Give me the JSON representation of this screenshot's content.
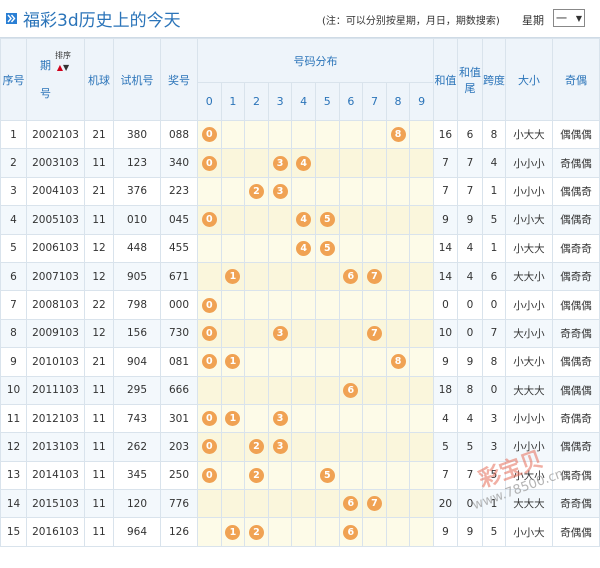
{
  "header": {
    "icon": "double-chevron-right-icon",
    "title": "福彩3d历史上的今天",
    "note": "(注：可以分别按星期，月日，期数搜索)",
    "week_label": "星期",
    "week_value": "一"
  },
  "columns": {
    "seq": "序号",
    "period": "期号",
    "sort_label": "排序",
    "machine": "机球",
    "trial": "试机号",
    "prize": "奖号",
    "distribution": "号码分布",
    "sum": "和值",
    "sum_tail": "和值尾",
    "span": "跨度",
    "size": "大小",
    "parity": "奇偶",
    "digits": [
      "0",
      "1",
      "2",
      "3",
      "4",
      "5",
      "6",
      "7",
      "8",
      "9"
    ]
  },
  "rows": [
    {
      "seq": "1",
      "period": "2002103",
      "machine": "21",
      "trial": "380",
      "prize": "088",
      "balls": [
        0,
        8
      ],
      "sum": "16",
      "tail": "6",
      "span": "8",
      "size": "小大大",
      "parity": "偶偶偶"
    },
    {
      "seq": "2",
      "period": "2003103",
      "machine": "11",
      "trial": "123",
      "prize": "340",
      "balls": [
        0,
        3,
        4
      ],
      "sum": "7",
      "tail": "7",
      "span": "4",
      "size": "小小小",
      "parity": "奇偶偶"
    },
    {
      "seq": "3",
      "period": "2004103",
      "machine": "21",
      "trial": "376",
      "prize": "223",
      "balls": [
        2,
        3
      ],
      "sum": "7",
      "tail": "7",
      "span": "1",
      "size": "小小小",
      "parity": "偶偶奇"
    },
    {
      "seq": "4",
      "period": "2005103",
      "machine": "11",
      "trial": "010",
      "prize": "045",
      "balls": [
        0,
        4,
        5
      ],
      "sum": "9",
      "tail": "9",
      "span": "5",
      "size": "小小大",
      "parity": "偶偶奇"
    },
    {
      "seq": "5",
      "period": "2006103",
      "machine": "12",
      "trial": "448",
      "prize": "455",
      "balls": [
        4,
        5
      ],
      "sum": "14",
      "tail": "4",
      "span": "1",
      "size": "小大大",
      "parity": "偶奇奇"
    },
    {
      "seq": "6",
      "period": "2007103",
      "machine": "12",
      "trial": "905",
      "prize": "671",
      "balls": [
        1,
        6,
        7
      ],
      "sum": "14",
      "tail": "4",
      "span": "6",
      "size": "大大小",
      "parity": "偶奇奇"
    },
    {
      "seq": "7",
      "period": "2008103",
      "machine": "22",
      "trial": "798",
      "prize": "000",
      "balls": [
        0
      ],
      "sum": "0",
      "tail": "0",
      "span": "0",
      "size": "小小小",
      "parity": "偶偶偶"
    },
    {
      "seq": "8",
      "period": "2009103",
      "machine": "12",
      "trial": "156",
      "prize": "730",
      "balls": [
        0,
        3,
        7
      ],
      "sum": "10",
      "tail": "0",
      "span": "7",
      "size": "大小小",
      "parity": "奇奇偶"
    },
    {
      "seq": "9",
      "period": "2010103",
      "machine": "21",
      "trial": "904",
      "prize": "081",
      "balls": [
        0,
        1,
        8
      ],
      "sum": "9",
      "tail": "9",
      "span": "8",
      "size": "小大小",
      "parity": "偶偶奇"
    },
    {
      "seq": "10",
      "period": "2011103",
      "machine": "11",
      "trial": "295",
      "prize": "666",
      "balls": [
        6
      ],
      "sum": "18",
      "tail": "8",
      "span": "0",
      "size": "大大大",
      "parity": "偶偶偶"
    },
    {
      "seq": "11",
      "period": "2012103",
      "machine": "11",
      "trial": "743",
      "prize": "301",
      "balls": [
        0,
        1,
        3
      ],
      "sum": "4",
      "tail": "4",
      "span": "3",
      "size": "小小小",
      "parity": "奇偶奇"
    },
    {
      "seq": "12",
      "period": "2013103",
      "machine": "11",
      "trial": "262",
      "prize": "203",
      "balls": [
        0,
        2,
        3
      ],
      "sum": "5",
      "tail": "5",
      "span": "3",
      "size": "小小小",
      "parity": "偶偶奇"
    },
    {
      "seq": "13",
      "period": "2014103",
      "machine": "11",
      "trial": "345",
      "prize": "250",
      "balls": [
        0,
        2,
        5
      ],
      "sum": "7",
      "tail": "7",
      "span": "5",
      "size": "小大小",
      "parity": "偶奇偶"
    },
    {
      "seq": "14",
      "period": "2015103",
      "machine": "11",
      "trial": "120",
      "prize": "776",
      "balls": [
        6,
        7
      ],
      "sum": "20",
      "tail": "0",
      "span": "1",
      "size": "大大大",
      "parity": "奇奇偶"
    },
    {
      "seq": "15",
      "period": "2016103",
      "machine": "11",
      "trial": "964",
      "prize": "126",
      "balls": [
        1,
        2,
        6
      ],
      "sum": "9",
      "tail": "9",
      "span": "5",
      "size": "小小大",
      "parity": "奇偶偶"
    }
  ],
  "watermark": {
    "brand": "彩宝贝",
    "url": "www.78500.cn"
  },
  "colors": {
    "title": "#2b74b9",
    "ball": "#f0a253",
    "header_bg": "#eef4fa",
    "distribution_bg": "#fdfbe8"
  }
}
